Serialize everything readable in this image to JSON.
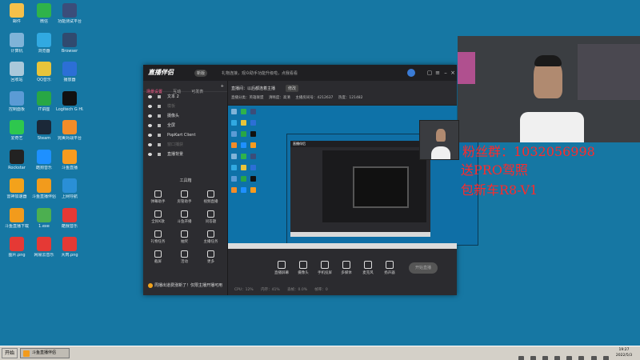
{
  "desktop_icons": [
    {
      "label": "邮件",
      "color": "#f6c04a"
    },
    {
      "label": "微信",
      "color": "#2fb34a"
    },
    {
      "label": "功能测试平台",
      "color": "#3b4d7a"
    },
    {
      "label": "计算机",
      "color": "#7fb3d8"
    },
    {
      "label": "浏览器",
      "color": "#31a9e1"
    },
    {
      "label": "Browser",
      "color": "#304a6f"
    },
    {
      "label": "回收站",
      "color": "#aac8da"
    },
    {
      "label": "QQ音乐",
      "color": "#e8c43a"
    },
    {
      "label": "播放器",
      "color": "#2c6fd6"
    },
    {
      "label": "控制面板",
      "color": "#5b9bd5"
    },
    {
      "label": "IT讲座",
      "color": "#28a745"
    },
    {
      "label": "Logitech G HUB",
      "color": "#111111"
    },
    {
      "label": "爱奇艺",
      "color": "#2ec74e"
    },
    {
      "label": "Steam",
      "color": "#1b2838"
    },
    {
      "label": "完美对战平台",
      "color": "#f28c28"
    },
    {
      "label": "Rockstar",
      "color": "#222222"
    },
    {
      "label": "酷狗音乐",
      "color": "#1e90ff"
    },
    {
      "label": "斗鱼直播",
      "color": "#f79b1f"
    },
    {
      "label": "雷神加速器",
      "color": "#f3a21b"
    },
    {
      "label": "斗鱼直播伴侣",
      "color": "#f29b1c"
    },
    {
      "label": "上网导航",
      "color": "#2a8fd6"
    },
    {
      "label": "斗鱼直播下载",
      "color": "#f29b1c"
    },
    {
      "label": "1.exe",
      "color": "#4caf50"
    },
    {
      "label": "酷我音乐",
      "color": "#e53935"
    },
    {
      "label": "图片.png",
      "color": "#e53935"
    },
    {
      "label": "网易云音乐",
      "color": "#e53935"
    },
    {
      "label": "大肉.png",
      "color": "#e53935"
    }
  ],
  "app": {
    "logo": "直播伴侣",
    "version": "新版",
    "notice": "礼物连接，观众助手功能升级啦，点我看看",
    "tabs": [
      "场景设置",
      "互动",
      "可发表"
    ],
    "sources": [
      {
        "label": "文本 2",
        "muted": false
      },
      {
        "label": "模板",
        "muted": true
      },
      {
        "label": "摄像头",
        "muted": false
      },
      {
        "label": "全屏",
        "muted": false
      },
      {
        "label": "PopKart Client",
        "muted": false
      },
      {
        "label": "窗口捕获",
        "muted": true
      },
      {
        "label": "直播背景",
        "muted": false
      }
    ],
    "tools_title": "工具箱",
    "tools": [
      "弹幕助手",
      "房管助手",
      "视频直播",
      "全民K歌",
      "斗鱼开播",
      "问答题",
      "礼物任务",
      "抽奖",
      "主播任务",
      "截屏",
      "活动",
      "更多"
    ],
    "room_title": "直播间：以后都连着主播",
    "edit_label": "修改",
    "room_meta": [
      "直播分类：英雄联盟",
      "清晰度：高清",
      "主播房间号：4212637",
      "热度：121482"
    ],
    "controls": [
      "直播屏幕",
      "摄像头",
      "手机投屏",
      "多媒体",
      "麦克风",
      "扬声器"
    ],
    "start_label": "开始直播",
    "status": [
      "CPU：12%",
      "内存：41%",
      "丢帧：0.0%",
      "帧率：0"
    ],
    "bottom_notice": "周播出道费涨新了！仅限主播开播可用"
  },
  "overlay": {
    "fans": "粉丝群：1032056998",
    "line2": "送PRO驾照",
    "line3": "包新车R8-V1"
  },
  "taskbar": {
    "start": "开始",
    "task": "斗鱼直播伴侣",
    "time": "19:27",
    "date": "2022/5/3"
  }
}
